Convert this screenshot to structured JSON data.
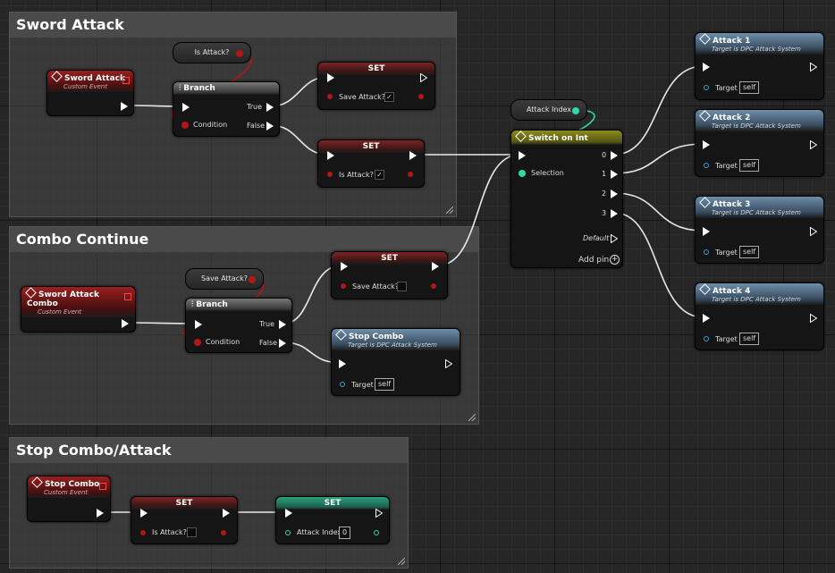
{
  "comments": {
    "sword_attack": "Sword Attack",
    "combo_continue": "Combo Continue",
    "stop_combo_attack": "Stop Combo/Attack"
  },
  "events": {
    "sword_attack": {
      "title": "Sword Attack",
      "subtitle": "Custom Event"
    },
    "sword_attack_combo": {
      "title": "Sword Attack Combo",
      "subtitle": "Custom Event"
    },
    "stop_combo": {
      "title": "Stop Combo",
      "subtitle": "Custom Event"
    }
  },
  "getters": {
    "is_attack": "Is Attack?",
    "save_attack": "Save Attack?",
    "attack_index": "Attack Index"
  },
  "branch": {
    "title": "Branch",
    "condition": "Condition",
    "true_label": "True",
    "false_label": "False"
  },
  "set_nodes": {
    "title": "SET",
    "save_attack_label": "Save Attack?",
    "is_attack_label": "Is Attack?",
    "attack_index_label": "Attack Index",
    "attack_index_value": "0",
    "check": "✓"
  },
  "stop_combo_fn": {
    "title": "Stop Combo",
    "subtitle": "Target is DPC Attack System",
    "target_label": "Target",
    "target_value": "self"
  },
  "switch": {
    "title": "Switch on Int",
    "selection": "Selection",
    "outputs": [
      "0",
      "1",
      "2",
      "3"
    ],
    "default_label": "Default",
    "add_pin": "Add pin"
  },
  "attacks": [
    {
      "title": "Attack 1",
      "subtitle": "Target is DPC Attack System",
      "target_label": "Target",
      "target_value": "self"
    },
    {
      "title": "Attack 2",
      "subtitle": "Target is DPC Attack System",
      "target_label": "Target",
      "target_value": "self"
    },
    {
      "title": "Attack 3",
      "subtitle": "Target is DPC Attack System",
      "target_label": "Target",
      "target_value": "self"
    },
    {
      "title": "Attack 4",
      "subtitle": "Target is DPC Attack System",
      "target_label": "Target",
      "target_value": "self"
    }
  ],
  "colors": {
    "exec": "#ffffff",
    "bool_pin": "#b31616",
    "int_pin": "#2cd9a7",
    "object_pin": "#2fa3d9",
    "event_header": "#9a1f1f",
    "function_header": "#6e8ea8",
    "switch_header": "#8b8b1f"
  },
  "icons": {
    "event": "event-diamond-icon",
    "function": "function-icon",
    "branch": "branch-icon",
    "add_pin": "plus-circle-icon",
    "resize": "resize-grip-icon"
  }
}
